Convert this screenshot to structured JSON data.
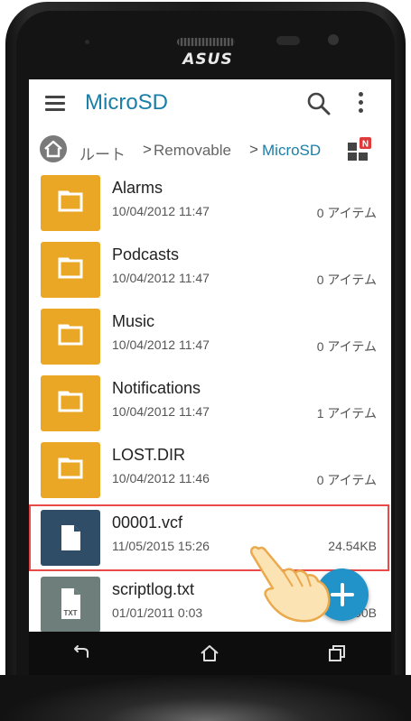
{
  "device": {
    "brand": "ASUS"
  },
  "appbar": {
    "title": "MicroSD"
  },
  "breadcrumb": {
    "items": [
      "ルート",
      "Removable",
      "MicroSD"
    ]
  },
  "files": [
    {
      "name": "Alarms",
      "date": "10/04/2012 11:47",
      "meta": "0 アイテム",
      "type": "folder"
    },
    {
      "name": "Podcasts",
      "date": "10/04/2012 11:47",
      "meta": "0 アイテム",
      "type": "folder"
    },
    {
      "name": "Music",
      "date": "10/04/2012 11:47",
      "meta": "0 アイテム",
      "type": "folder"
    },
    {
      "name": "Notifications",
      "date": "10/04/2012 11:47",
      "meta": "1 アイテム",
      "type": "folder"
    },
    {
      "name": "LOST.DIR",
      "date": "10/04/2012 11:46",
      "meta": "0 アイテム",
      "type": "folder"
    },
    {
      "name": "00001.vcf",
      "date": "11/05/2015 15:26",
      "meta": "24.54KB",
      "type": "file"
    },
    {
      "name": "scriptlog.txt",
      "date": "01/01/2011 0:03",
      "meta": "4.00B",
      "type": "txt"
    }
  ],
  "txt_badge": "TXT",
  "colors": {
    "accent": "#1a7fa8",
    "folder": "#eaa726",
    "fab": "#2193c9",
    "highlight": "#e84a4a"
  },
  "icons": [
    "menu-icon",
    "search-icon",
    "more-vert-icon",
    "home-icon",
    "grid-view-icon",
    "folder-icon",
    "file-icon",
    "add-icon",
    "back-icon",
    "home-nav-icon",
    "recents-icon"
  ]
}
